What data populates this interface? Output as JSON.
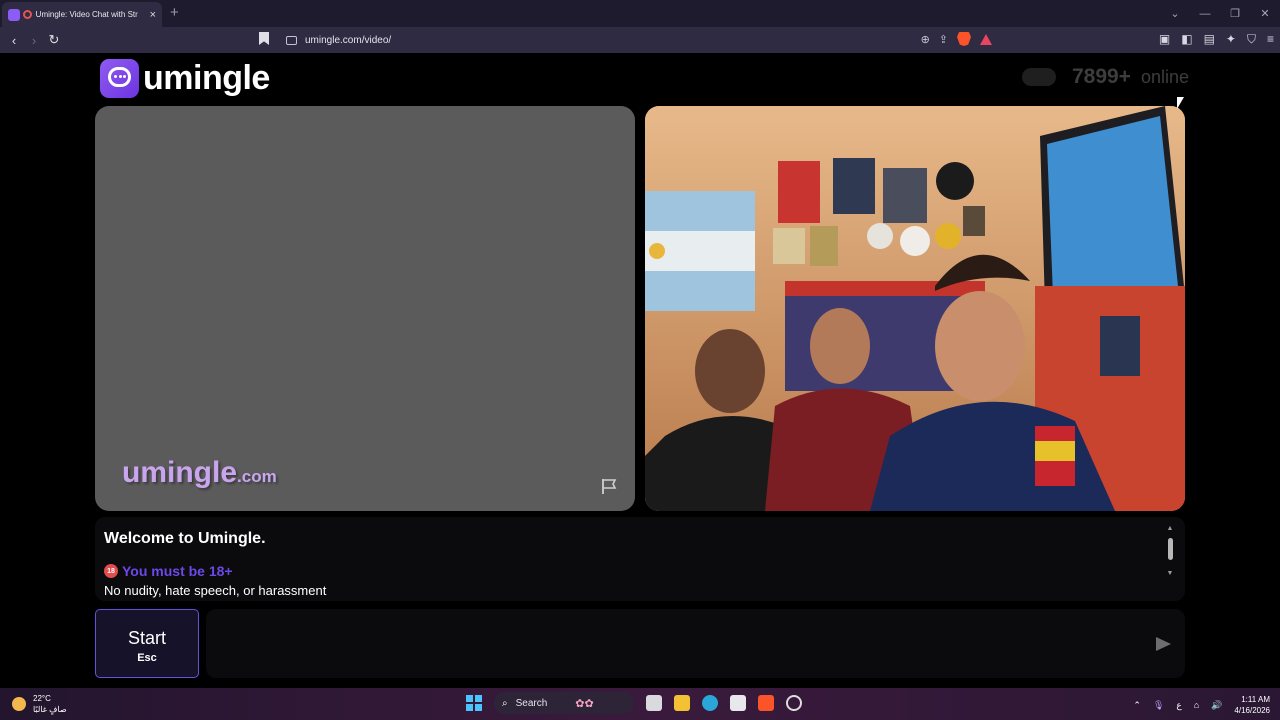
{
  "browser": {
    "tab_title": "Umingle: Video Chat with Str",
    "url": "umingle.com/video/",
    "close_symbol": "×",
    "new_tab_symbol": "+"
  },
  "header": {
    "logo_text": "umingle",
    "online_count": "7899+",
    "online_label": "online"
  },
  "left_video": {
    "watermark_main": "umingle",
    "watermark_suffix": ".com"
  },
  "chat": {
    "welcome": "Welcome to Umingle.",
    "age_badge": "18",
    "age_warning": "You must be 18+",
    "rules": "No nudity, hate speech, or harassment"
  },
  "controls": {
    "start_label": "Start",
    "start_hint": "Esc",
    "message_placeholder": ""
  },
  "taskbar": {
    "temperature": "22°C",
    "weather_desc": "صافٍ غالبًا",
    "search_label": "Search",
    "time": "1:11 AM",
    "date": "4/16/2026",
    "lang": "ع"
  },
  "colors": {
    "accent": "#7c4ee8",
    "left_video_bg": "#5b5b5b",
    "age_warning": "#6d48e8"
  }
}
